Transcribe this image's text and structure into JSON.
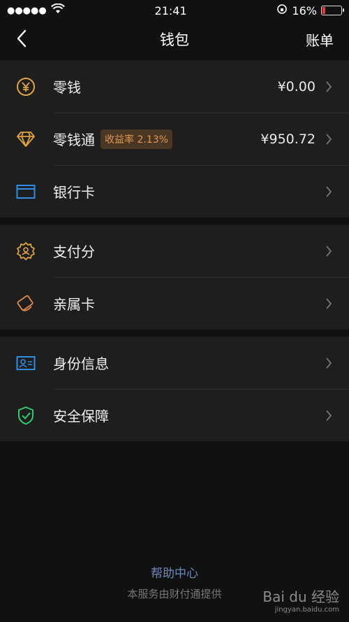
{
  "status_bar": {
    "signal": "●●●●●",
    "time": "21:41",
    "battery_percent": "16%",
    "battery_level": 0.16,
    "battery_color": "#e53935"
  },
  "navbar": {
    "title": "钱包",
    "right_label": "账单"
  },
  "sections": [
    [
      {
        "label": "零钱",
        "value": "¥0.00",
        "icon": "yuan-coin-icon"
      },
      {
        "label": "零钱通",
        "badge": "收益率 2.13%",
        "value": "¥950.72",
        "icon": "diamond-icon"
      },
      {
        "label": "银行卡",
        "icon": "bank-card-icon"
      }
    ],
    [
      {
        "label": "支付分",
        "icon": "pay-score-icon"
      },
      {
        "label": "亲属卡",
        "icon": "family-card-icon"
      }
    ],
    [
      {
        "label": "身份信息",
        "icon": "id-card-icon"
      },
      {
        "label": "安全保障",
        "icon": "shield-check-icon"
      }
    ]
  ],
  "footer": {
    "help_link": "帮助中心",
    "provider_note": "本服务由财付通提供"
  },
  "watermark": {
    "brand": "Bai du 经验",
    "url": "jingyan.baidu.com"
  },
  "colors": {
    "gold": "#e0a43c",
    "blue": "#2f8de4",
    "green": "#2ecc71",
    "orange": "#e08a4c"
  }
}
